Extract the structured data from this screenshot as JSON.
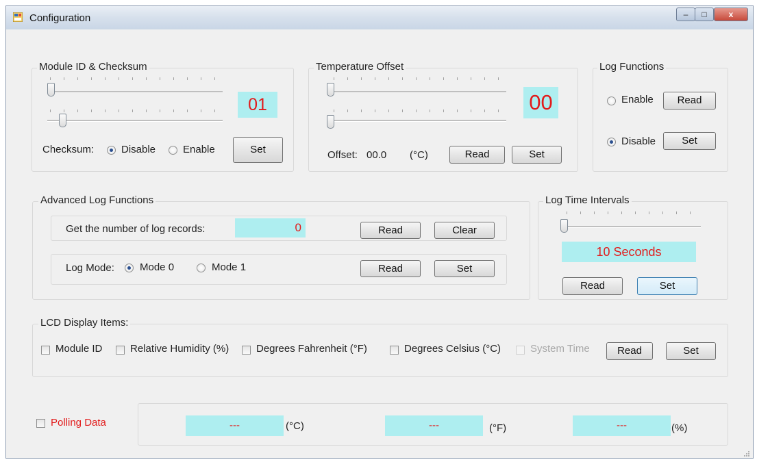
{
  "window": {
    "title": "Configuration",
    "minimize": "–",
    "maximize": "□",
    "close": "x"
  },
  "module": {
    "group_title": "Module ID & Checksum",
    "id_value": "01",
    "checksum_label": "Checksum:",
    "disable_label": "Disable",
    "enable_label": "Enable",
    "checksum_selected": "Disable",
    "set_label": "Set"
  },
  "temp_offset": {
    "group_title": "Temperature Offset",
    "value": "00",
    "offset_label": "Offset:",
    "offset_value": "00.0",
    "unit": "(°C)",
    "read_label": "Read",
    "set_label": "Set"
  },
  "log_functions": {
    "group_title": "Log Functions",
    "enable_label": "Enable",
    "disable_label": "Disable",
    "selected": "Disable",
    "read_label": "Read",
    "set_label": "Set"
  },
  "advanced": {
    "group_title": "Advanced Log Functions",
    "records_label": "Get the number of log records:",
    "records_value": "0",
    "read_label": "Read",
    "clear_label": "Clear",
    "mode_label": "Log Mode:",
    "mode0_label": "Mode 0",
    "mode1_label": "Mode 1",
    "mode_selected": "Mode 0",
    "mode_read_label": "Read",
    "mode_set_label": "Set"
  },
  "intervals": {
    "group_title": "Log Time Intervals",
    "value": "10 Seconds",
    "read_label": "Read",
    "set_label": "Set"
  },
  "lcd": {
    "group_title": "LCD Display Items:",
    "items": [
      {
        "label": "Module ID",
        "checked": false,
        "enabled": true
      },
      {
        "label": "Relative Humidity (%)",
        "checked": false,
        "enabled": true
      },
      {
        "label": "Degrees Fahrenheit  (°F)",
        "checked": false,
        "enabled": true
      },
      {
        "label": "Degrees Celsius (°C)",
        "checked": false,
        "enabled": true
      },
      {
        "label": "System Time",
        "checked": false,
        "enabled": false
      }
    ],
    "read_label": "Read",
    "set_label": "Set"
  },
  "polling": {
    "label": "Polling Data",
    "checked": false,
    "celsius_value": "---",
    "celsius_unit": "(°C)",
    "fahrenheit_value": "---",
    "fahrenheit_unit": "(°F)",
    "humidity_value": "---",
    "humidity_unit": "(%)"
  },
  "colors": {
    "display_bg": "#aeeef0",
    "display_text": "#e21b1b",
    "window_bg": "#f0f0f0"
  }
}
